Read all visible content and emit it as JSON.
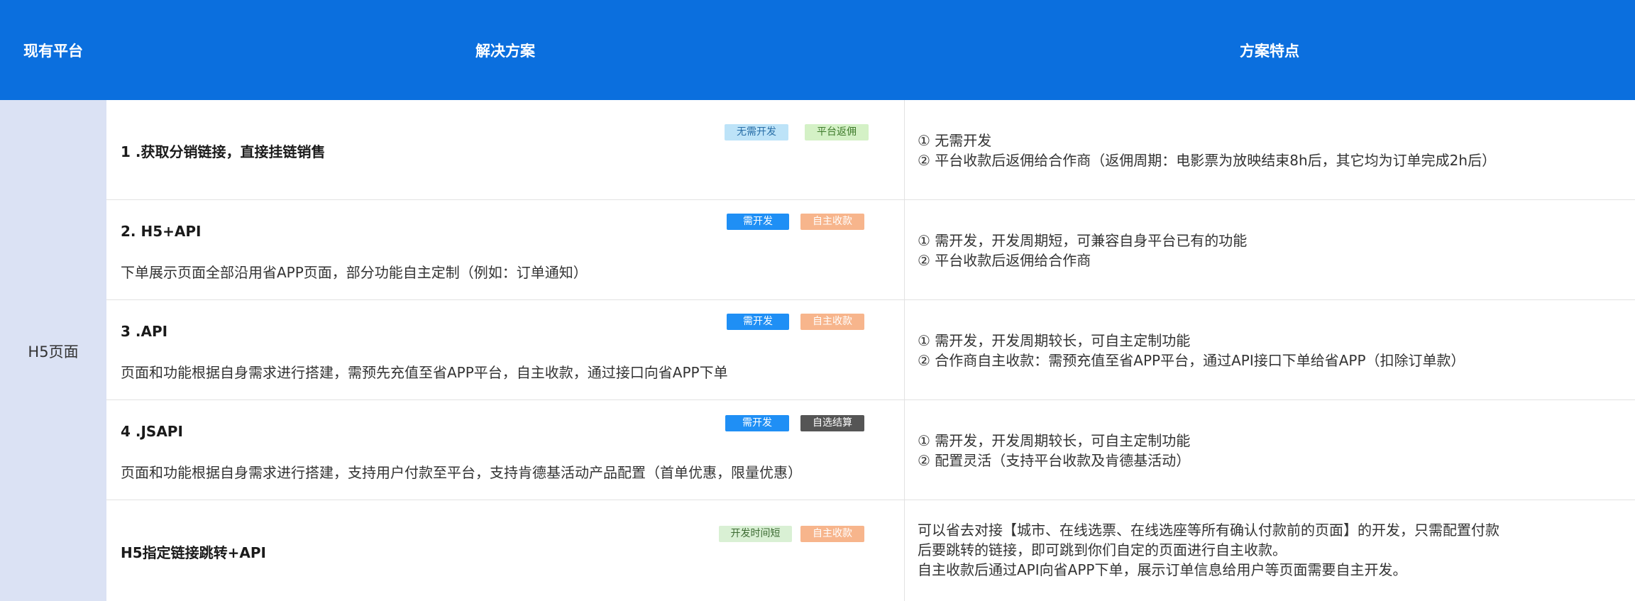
{
  "headers": {
    "platform": "现有平台",
    "solution": "解决方案",
    "features": "方案特点"
  },
  "platform": "H5页面",
  "rows": [
    {
      "title": "1 .获取分销链接，直接挂链销售",
      "desc": "",
      "tags": [
        {
          "label": "无需开发",
          "bg": "#bde3f8",
          "color": "#2a6fa8"
        },
        {
          "label": "平台返佣",
          "bg": "#d4f1c6",
          "color": "#3d7a2a"
        }
      ],
      "features": [
        "① 无需开发",
        "② 平台收款后返佣给合作商（返佣周期：电影票为放映结束8h后，其它均为订单完成2h后）"
      ]
    },
    {
      "title": "2. H5+API",
      "desc": "下单展示页面全部沿用省APP页面，部分功能自主定制（例如：订单通知）",
      "tags": [
        {
          "label": "需开发",
          "bg": "#1f8ff5",
          "color": "#ffffff"
        },
        {
          "label": "自主收款",
          "bg": "#f7b58c",
          "color": "#ffffff"
        }
      ],
      "features": [
        "① 需开发，开发周期短，可兼容自身平台已有的功能",
        "② 平台收款后返佣给合作商"
      ]
    },
    {
      "title": "3 .API",
      "desc": "页面和功能根据自身需求进行搭建，需预先充值至省APP平台，自主收款，通过接口向省APP下单",
      "tags": [
        {
          "label": "需开发",
          "bg": "#1f8ff5",
          "color": "#ffffff"
        },
        {
          "label": "自主收款",
          "bg": "#f7b58c",
          "color": "#ffffff"
        }
      ],
      "features": [
        "① 需开发，开发周期较长，可自主定制功能",
        "② 合作商自主收款：需预充值至省APP平台，通过API接口下单给省APP（扣除订单款）"
      ]
    },
    {
      "title": "4 .JSAPI",
      "desc": "页面和功能根据自身需求进行搭建，支持用户付款至平台，支持肯德基活动产品配置（首单优惠，限量优惠）",
      "tags": [
        {
          "label": "需开发",
          "bg": "#1f8ff5",
          "color": "#ffffff"
        },
        {
          "label": "自选结算",
          "bg": "#555555",
          "color": "#ffffff"
        }
      ],
      "features": [
        "① 需开发，开发周期较长，可自主定制功能",
        "② 配置灵活（支持平台收款及肯德基活动）"
      ]
    },
    {
      "title": "H5指定链接跳转+API",
      "desc": "",
      "tags": [
        {
          "label": "开发时间短",
          "bg": "#d9f0d4",
          "color": "#3d6b33"
        },
        {
          "label": "自主收款",
          "bg": "#f7b58c",
          "color": "#ffffff"
        }
      ],
      "features": [
        "可以省去对接【城市、在线选票、在线选座等所有确认付款前的页面】的开发，只需配置付款",
        "后要跳转的链接，即可跳到你们自定的页面进行自主收款。",
        "自主收款后通过API向省APP下单，展示订单信息给用户等页面需要自主开发。"
      ]
    }
  ]
}
